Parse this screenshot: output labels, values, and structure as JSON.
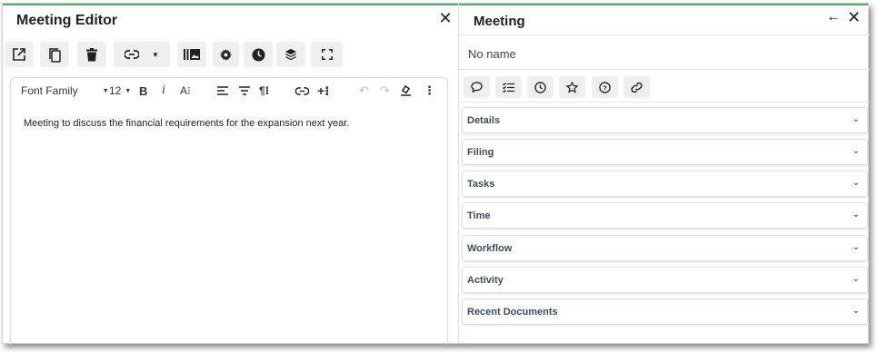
{
  "editor": {
    "title": "Meeting Editor",
    "toolbar_icons": [
      "open-external-icon",
      "copy-icon",
      "delete-icon",
      "link-icon",
      "library-icon",
      "gear-icon",
      "clock-icon",
      "layers-icon",
      "fullscreen-icon"
    ],
    "format": {
      "font_family": "Font Family",
      "font_size": "12"
    },
    "content": "Meeting to discuss the financial requirements for the expansion next year."
  },
  "meeting": {
    "title": "Meeting",
    "name": "No name",
    "action_icons": [
      "comment-icon",
      "checklist-icon",
      "clock-icon",
      "star-icon",
      "help-icon",
      "link-icon"
    ],
    "sections": [
      {
        "label": "Details"
      },
      {
        "label": "Filing"
      },
      {
        "label": "Tasks"
      },
      {
        "label": "Time"
      },
      {
        "label": "Workflow"
      },
      {
        "label": "Activity"
      },
      {
        "label": "Recent Documents"
      }
    ]
  },
  "colors": {
    "accent": "#4caf6a",
    "section_label": "#3d4b5c",
    "button_bg": "#efefef"
  }
}
